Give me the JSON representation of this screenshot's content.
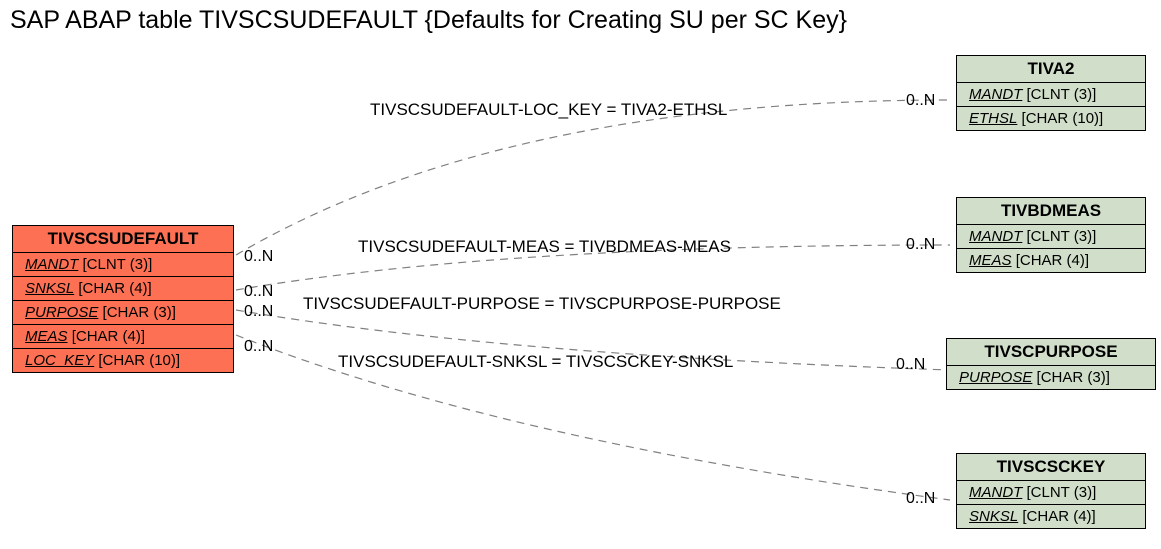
{
  "title": "SAP ABAP table TIVSCSUDEFAULT {Defaults for Creating SU per SC Key}",
  "main_table": {
    "name": "TIVSCSUDEFAULT",
    "fields": [
      {
        "key": "MANDT",
        "type": "[CLNT (3)]"
      },
      {
        "key": "SNKSL",
        "type": "[CHAR (4)]"
      },
      {
        "key": "PURPOSE",
        "type": "[CHAR (3)]"
      },
      {
        "key": "MEAS",
        "type": "[CHAR (4)]"
      },
      {
        "key": "LOC_KEY",
        "type": "[CHAR (10)]"
      }
    ]
  },
  "related_tables": [
    {
      "name": "TIVA2",
      "fields": [
        {
          "key": "MANDT",
          "type": "[CLNT (3)]"
        },
        {
          "key": "ETHSL",
          "type": "[CHAR (10)]"
        }
      ]
    },
    {
      "name": "TIVBDMEAS",
      "fields": [
        {
          "key": "MANDT",
          "type": "[CLNT (3)]"
        },
        {
          "key": "MEAS",
          "type": "[CHAR (4)]"
        }
      ]
    },
    {
      "name": "TIVSCPURPOSE",
      "fields": [
        {
          "key": "PURPOSE",
          "type": "[CHAR (3)]"
        }
      ]
    },
    {
      "name": "TIVSCSCKEY",
      "fields": [
        {
          "key": "MANDT",
          "type": "[CLNT (3)]"
        },
        {
          "key": "SNKSL",
          "type": "[CHAR (4)]"
        }
      ]
    }
  ],
  "relations": [
    {
      "label": "TIVSCSUDEFAULT-LOC_KEY = TIVA2-ETHSL",
      "left_card": "0..N",
      "right_card": "0..N"
    },
    {
      "label": "TIVSCSUDEFAULT-MEAS = TIVBDMEAS-MEAS",
      "left_card": "0..N",
      "right_card": "0..N"
    },
    {
      "label": "TIVSCSUDEFAULT-PURPOSE = TIVSCPURPOSE-PURPOSE",
      "left_card": "0..N",
      "right_card": "0..N"
    },
    {
      "label": "TIVSCSUDEFAULT-SNKSL = TIVSCSCKEY-SNKSL",
      "left_card": "0..N",
      "right_card": "0..N"
    }
  ]
}
